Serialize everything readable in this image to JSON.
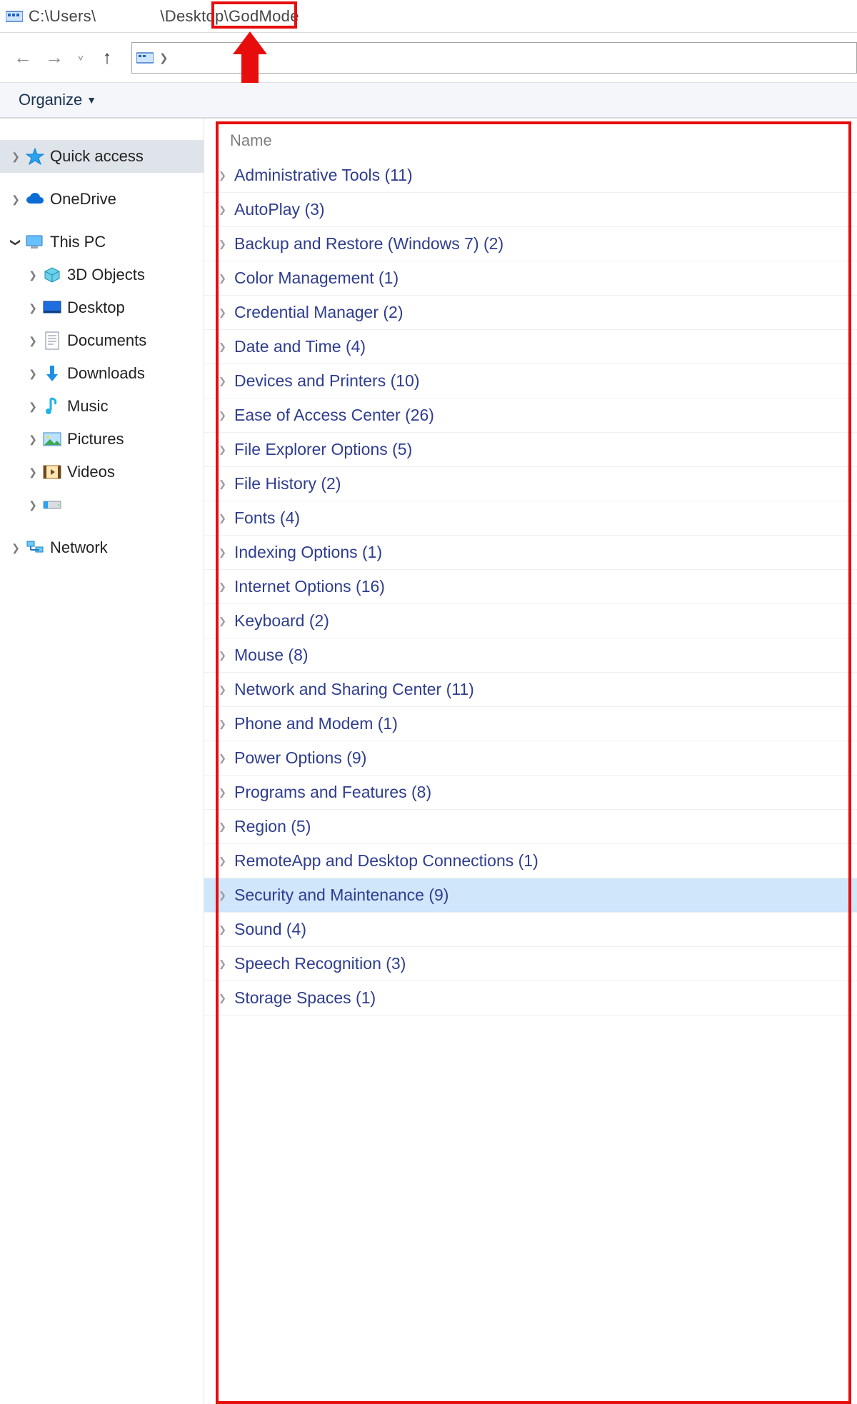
{
  "titlebar": {
    "path_prefix": "C:\\Users\\",
    "path_middle": "\\Desktop\\",
    "path_folder": "GodMode"
  },
  "commandbar": {
    "organize": "Organize"
  },
  "sidebar": {
    "quick_access": "Quick access",
    "onedrive": "OneDrive",
    "this_pc": "This PC",
    "children": [
      {
        "label": "3D Objects"
      },
      {
        "label": "Desktop"
      },
      {
        "label": "Documents"
      },
      {
        "label": "Downloads"
      },
      {
        "label": "Music"
      },
      {
        "label": "Pictures"
      },
      {
        "label": "Videos"
      },
      {
        "label": ""
      }
    ],
    "network": "Network"
  },
  "filelist": {
    "column_name": "Name",
    "items": [
      {
        "label": "Administrative Tools (11)"
      },
      {
        "label": "AutoPlay (3)"
      },
      {
        "label": "Backup and Restore (Windows 7) (2)"
      },
      {
        "label": "Color Management (1)"
      },
      {
        "label": "Credential Manager (2)"
      },
      {
        "label": "Date and Time (4)"
      },
      {
        "label": "Devices and Printers (10)"
      },
      {
        "label": "Ease of Access Center (26)"
      },
      {
        "label": "File Explorer Options (5)"
      },
      {
        "label": "File History (2)"
      },
      {
        "label": "Fonts (4)"
      },
      {
        "label": "Indexing Options (1)"
      },
      {
        "label": "Internet Options (16)"
      },
      {
        "label": "Keyboard (2)"
      },
      {
        "label": "Mouse (8)"
      },
      {
        "label": "Network and Sharing Center (11)"
      },
      {
        "label": "Phone and Modem (1)"
      },
      {
        "label": "Power Options (9)"
      },
      {
        "label": "Programs and Features (8)"
      },
      {
        "label": "Region (5)"
      },
      {
        "label": "RemoteApp and Desktop Connections (1)"
      },
      {
        "label": "Security and Maintenance (9)",
        "selected": true
      },
      {
        "label": "Sound (4)"
      },
      {
        "label": "Speech Recognition (3)"
      },
      {
        "label": "Storage Spaces (1)"
      }
    ]
  }
}
